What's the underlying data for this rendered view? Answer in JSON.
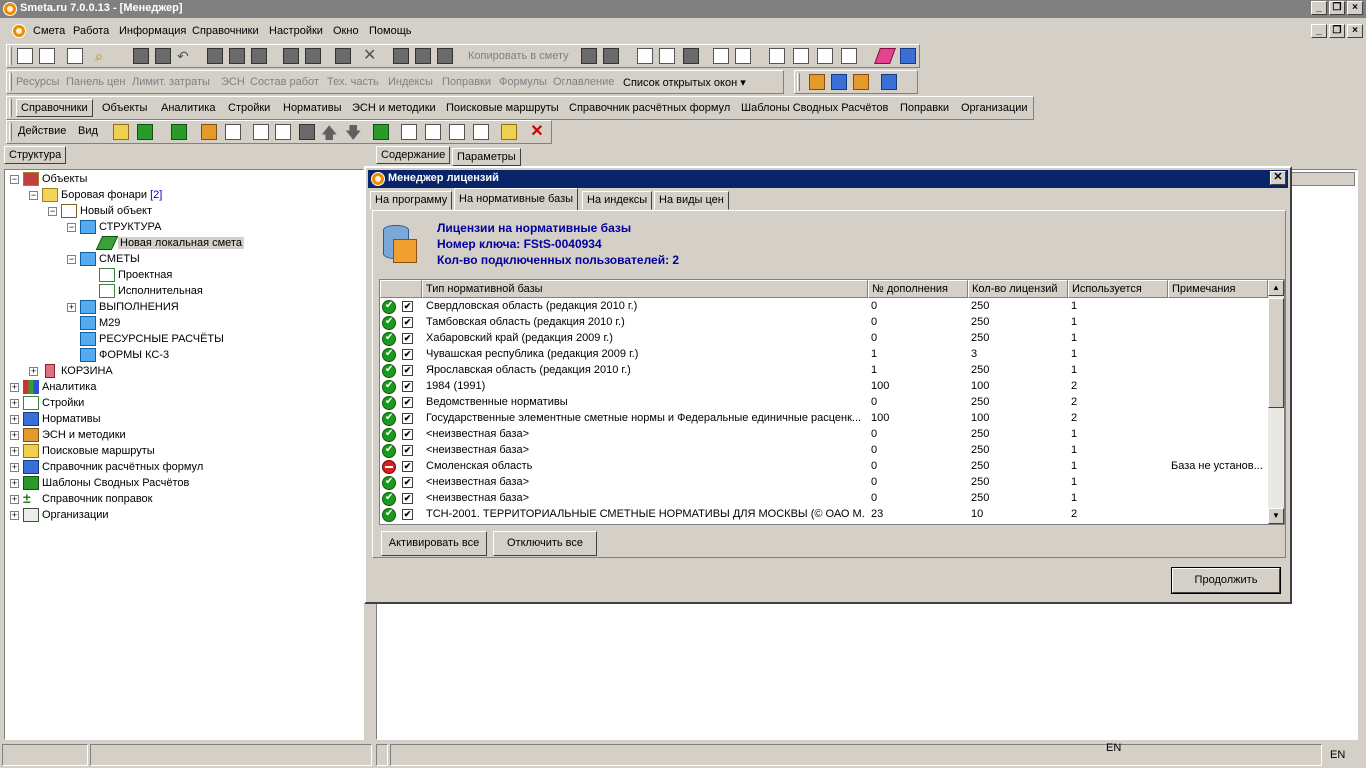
{
  "window": {
    "title": "Smeta.ru  7.0.0.13  - [Менеджер]"
  },
  "menu": [
    "Смета",
    "Работа",
    "Информация",
    "Справочники",
    "Настройки",
    "Окно",
    "Помощь"
  ],
  "toolbar1": {
    "copy_to_estimate": "Копировать в смету"
  },
  "toolbar2": {
    "items": [
      "Ресурсы",
      "Панель цен",
      "Лимит. затраты",
      "ЭСН",
      "Состав работ",
      "Тех. часть",
      "Индексы",
      "Поправки",
      "Формулы",
      "Оглавление"
    ],
    "open_windows": "Список открытых окон"
  },
  "tabs": [
    "Справочники",
    "Объекты",
    "Аналитика",
    "Стройки",
    "Нормативы",
    "ЭСН и методики",
    "Поисковые маршруты",
    "Справочник расчётных формул",
    "Шаблоны Сводных Расчётов",
    "Поправки",
    "Организации"
  ],
  "actions": {
    "action": "Действие",
    "view": "Вид"
  },
  "left_tab": "Структура",
  "right_tabs": [
    "Содержание",
    "Параметры"
  ],
  "tree": [
    {
      "label": "Объекты",
      "count": "",
      "selected": false
    },
    {
      "label": "Боровая фонари",
      "count": "[2]",
      "selected": false
    },
    {
      "label": "Новый объект",
      "count": "",
      "selected": false
    },
    {
      "label": "СТРУКТУРА",
      "count": "",
      "selected": false
    },
    {
      "label": "Новая локальная смета",
      "count": "",
      "selected": true
    },
    {
      "label": "СМЕТЫ",
      "count": "",
      "selected": false
    },
    {
      "label": "Проектная",
      "count": "",
      "selected": false
    },
    {
      "label": "Исполнительная",
      "count": "",
      "selected": false
    },
    {
      "label": "ВЫПОЛНЕНИЯ",
      "count": "",
      "selected": false
    },
    {
      "label": "М29",
      "count": "",
      "selected": false
    },
    {
      "label": "РЕСУРСНЫЕ РАСЧЁТЫ",
      "count": "",
      "selected": false
    },
    {
      "label": "ФОРМЫ КС-3",
      "count": "",
      "selected": false
    },
    {
      "label": "КОРЗИНА",
      "count": "",
      "selected": false
    },
    {
      "label": "Аналитика",
      "count": "",
      "selected": false
    },
    {
      "label": "Стройки",
      "count": "",
      "selected": false
    },
    {
      "label": "Нормативы",
      "count": "",
      "selected": false
    },
    {
      "label": "ЭСН и методики",
      "count": "",
      "selected": false
    },
    {
      "label": "Поисковые маршруты",
      "count": "",
      "selected": false
    },
    {
      "label": "Справочник расчётных формул",
      "count": "",
      "selected": false
    },
    {
      "label": "Шаблоны Сводных Расчётов",
      "count": "",
      "selected": false
    },
    {
      "label": "Справочник поправок",
      "count": "",
      "selected": false
    },
    {
      "label": "Организации",
      "count": "",
      "selected": false
    }
  ],
  "dialog": {
    "title": "Менеджер лицензий",
    "tabs": [
      "На программу",
      "На нормативные базы",
      "На индексы",
      "На виды цен"
    ],
    "heading": "Лицензии на нормативные базы",
    "key": "Номер ключа: FStS-0040934",
    "users": "Кол-во подключенных пользователей: 2",
    "columns": [
      "Тип нормативной базы",
      "№ дополнения",
      "Кол-во лицензий",
      "Используется",
      "Примечания"
    ],
    "rows": [
      {
        "status": "ok",
        "checked": "✔",
        "name": "Свердловская область (редакция 2010 г.)",
        "addon": "0",
        "licenses": "250",
        "used": "1",
        "note": ""
      },
      {
        "status": "ok",
        "checked": "✔",
        "name": "Тамбовская область  (редакция 2010 г.)",
        "addon": "0",
        "licenses": "250",
        "used": "1",
        "note": ""
      },
      {
        "status": "ok",
        "checked": "✔",
        "name": "Хабаровский край  (редакция 2009 г.)",
        "addon": "0",
        "licenses": "250",
        "used": "1",
        "note": ""
      },
      {
        "status": "ok",
        "checked": "✔",
        "name": "Чувашская республика (редакция 2009 г.)",
        "addon": "1",
        "licenses": "3",
        "used": "1",
        "note": ""
      },
      {
        "status": "ok",
        "checked": "✔",
        "name": "Ярославская область (редакция 2010 г.)",
        "addon": "1",
        "licenses": "250",
        "used": "1",
        "note": ""
      },
      {
        "status": "ok",
        "checked": "✔",
        "name": "1984 (1991)",
        "addon": "100",
        "licenses": "100",
        "used": "2",
        "note": ""
      },
      {
        "status": "ok",
        "checked": "✔",
        "name": "Ведомственные нормативы",
        "addon": "0",
        "licenses": "250",
        "used": "2",
        "note": ""
      },
      {
        "status": "ok",
        "checked": "✔",
        "name": "Государственные элементные сметные нормы и Федеральные единичные расценк...",
        "addon": "100",
        "licenses": "100",
        "used": "2",
        "note": ""
      },
      {
        "status": "ok",
        "checked": "✔",
        "name": "<неизвестная база>",
        "addon": "0",
        "licenses": "250",
        "used": "1",
        "note": ""
      },
      {
        "status": "ok",
        "checked": "✔",
        "name": "<неизвестная база>",
        "addon": "0",
        "licenses": "250",
        "used": "1",
        "note": ""
      },
      {
        "status": "error",
        "checked": "✔",
        "name": "Смоленская область",
        "addon": "0",
        "licenses": "250",
        "used": "1",
        "note": "База не установ..."
      },
      {
        "status": "ok",
        "checked": "✔",
        "name": "<неизвестная база>",
        "addon": "0",
        "licenses": "250",
        "used": "1",
        "note": ""
      },
      {
        "status": "ok",
        "checked": "✔",
        "name": "<неизвестная база>",
        "addon": "0",
        "licenses": "250",
        "used": "1",
        "note": ""
      },
      {
        "status": "ok",
        "checked": "✔",
        "name": "ТСН-2001. ТЕРРИТОРИАЛЬНЫЕ СМЕТНЫЕ НОРМАТИВЫ ДЛЯ МОСКВЫ (© ОАО М...",
        "addon": "23",
        "licenses": "10",
        "used": "2",
        "note": ""
      }
    ],
    "activate_all": "Активировать все",
    "disable_all": "Отключить все",
    "continue": "Продолжить"
  },
  "status": {
    "lang1": "EN",
    "lang2": "EN"
  }
}
